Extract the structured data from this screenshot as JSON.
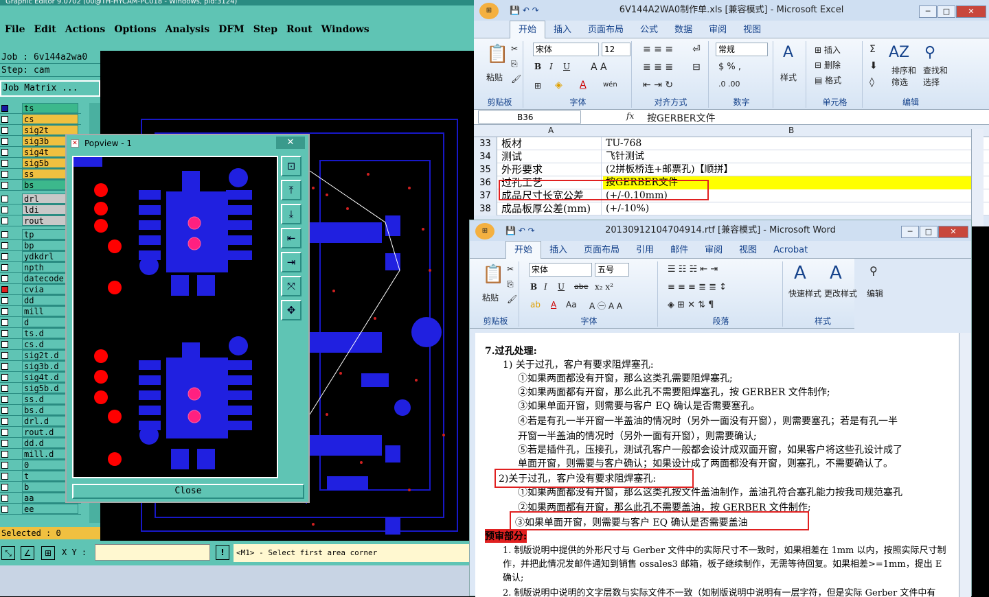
{
  "genesis": {
    "title": "Graphic Editor 9.0702 (00@TH-HYCAM-PC018 - Windows, pid:3124)",
    "menu": [
      "File",
      "Edit",
      "Actions",
      "Options",
      "Analysis",
      "DFM",
      "Step",
      "Rout",
      "Windows"
    ],
    "job_line": "Job : 6v144a2wa0",
    "step_line": "Step: cam",
    "matrix_btn": "Job Matrix ...",
    "layers": [
      {
        "name": "ts",
        "color": "#3cb88c"
      },
      {
        "name": "cs",
        "color": "#f0c040"
      },
      {
        "name": "sig2t",
        "color": "#f0c040"
      },
      {
        "name": "sig3b",
        "color": "#f0c040"
      },
      {
        "name": "sig4t",
        "color": "#f0c040"
      },
      {
        "name": "sig5b",
        "color": "#f0c040"
      },
      {
        "name": "ss",
        "color": "#f0c040"
      },
      {
        "name": "bs",
        "color": "#3cb88c"
      },
      {
        "name": "drl",
        "color": "#c8c8c8"
      },
      {
        "name": "ldi",
        "color": "#c8c8c8"
      },
      {
        "name": "rout",
        "color": "#c8c8c8"
      },
      {
        "name": "tp",
        "color": "#5fc4b4"
      },
      {
        "name": "bp",
        "color": "#5fc4b4"
      },
      {
        "name": "ydkdrl",
        "color": "#5fc4b4"
      },
      {
        "name": "npth",
        "color": "#5fc4b4"
      },
      {
        "name": "datecode",
        "color": "#5fc4b4"
      },
      {
        "name": "cvia",
        "color": "#5fc4b4"
      },
      {
        "name": "dd",
        "color": "#5fc4b4"
      },
      {
        "name": "mill",
        "color": "#5fc4b4"
      },
      {
        "name": "d",
        "color": "#5fc4b4"
      },
      {
        "name": "ts.d",
        "color": "#5fc4b4"
      },
      {
        "name": "cs.d",
        "color": "#5fc4b4"
      },
      {
        "name": "sig2t.d",
        "color": "#5fc4b4"
      },
      {
        "name": "sig3b.d",
        "color": "#5fc4b4"
      },
      {
        "name": "sig4t.d",
        "color": "#5fc4b4"
      },
      {
        "name": "sig5b.d",
        "color": "#5fc4b4"
      },
      {
        "name": "ss.d",
        "color": "#5fc4b4"
      },
      {
        "name": "bs.d",
        "color": "#5fc4b4"
      },
      {
        "name": "drl.d",
        "color": "#5fc4b4"
      },
      {
        "name": "rout.d",
        "color": "#5fc4b4"
      },
      {
        "name": "dd.d",
        "color": "#5fc4b4"
      },
      {
        "name": "mill.d",
        "color": "#5fc4b4"
      },
      {
        "name": "0",
        "color": "#5fc4b4"
      },
      {
        "name": "t",
        "color": "#5fc4b4"
      },
      {
        "name": "b",
        "color": "#5fc4b4"
      },
      {
        "name": "aa",
        "color": "#5fc4b4"
      },
      {
        "name": "ee",
        "color": "#5fc4b4"
      }
    ],
    "selected": "Selected : 0",
    "xy_label": "X Y :",
    "status_msg": "<M1> - Select first area corner",
    "popview": {
      "title": "Popview - 1",
      "close": "Close"
    }
  },
  "excel": {
    "title": "6V144A2WA0制作单.xls [兼容模式] - Microsoft Excel",
    "tabs": [
      "开始",
      "插入",
      "页面布局",
      "公式",
      "数据",
      "审阅",
      "视图"
    ],
    "font_name": "宋体",
    "font_size": "12",
    "num_format": "常规",
    "groups": [
      "剪贴板",
      "字体",
      "对齐方式",
      "数字",
      "单元格",
      "编辑"
    ],
    "paste": "粘贴",
    "styles": "样式",
    "cells_btns": [
      "插入",
      "删除",
      "格式"
    ],
    "edit_btns": [
      "排序和筛选",
      "查找和选择"
    ],
    "name_box": "B36",
    "fx": "fx",
    "formula": "按GERBER文件",
    "cols": [
      "A",
      "B"
    ],
    "rows": [
      {
        "n": "33",
        "a": "板材",
        "b": "TU-768"
      },
      {
        "n": "34",
        "a": "测试",
        "b": "飞针测试"
      },
      {
        "n": "35",
        "a": "外形要求",
        "b": "(2拼板桥连+邮票孔)【顺拼】"
      },
      {
        "n": "36",
        "a": "过孔工艺",
        "b": "按GERBER文件"
      },
      {
        "n": "37",
        "a": "成品尺寸长宽公差",
        "b": "(+/-0.10mm)"
      },
      {
        "n": "38",
        "a": "成品板厚公差(mm)",
        "b": "(+/-10%)"
      }
    ]
  },
  "word": {
    "title": "20130912104704914.rtf [兼容模式] - Microsoft Word",
    "tabs": [
      "开始",
      "插入",
      "页面布局",
      "引用",
      "邮件",
      "审阅",
      "视图",
      "Acrobat"
    ],
    "font_name": "宋体",
    "font_size": "五号",
    "groups": [
      "剪贴板",
      "字体",
      "段落",
      "样式"
    ],
    "paste": "粘贴",
    "quick_style": "快速样式",
    "change_style": "更改样式",
    "edit": "编辑",
    "lines": [
      "7.过孔处理:",
      "1) 关于过孔，客户有要求阻焊塞孔:",
      "①如果两面都没有开窗，那么这类孔需要阻焊塞孔;",
      "②如果两面都有开窗，那么此孔不需要阻焊塞孔，按 GERBER 文件制作;",
      "③如果单面开窗，则需要与客户 EQ 确认是否需要塞孔。",
      "④若是有孔一半开窗一半盖油的情况时（另外一面没有开窗），则需要塞孔；若是有孔一半",
      "开窗一半盖油的情况时（另外一面有开窗），则需要确认;",
      "⑤若是插件孔，压接孔，测试孔客户一般都会设计成双面开窗，如果客户将这些孔设计成了",
      "单面开窗，则需要与客户确认；如果设计成了两面都没有开窗，则塞孔，不需要确认了。",
      "2)关于过孔，客户没有要求阻焊塞孔:",
      "①如果两面都没有开窗，那么这类孔按文件盖油制作，盖油孔符合塞孔能力按我司规范塞孔",
      "②如果两面都有开窗，那么此孔不需要盖油，按 GERBER 文件制作;",
      "③如果单面开窗，则需要与客户 EQ 确认是否需要盖油",
      "预审部分:",
      "1. 制版说明中提供的外形尺寸与 Gerber 文件中的实际尺寸不一致时，如果相差在 1mm 以内，按照实际尺寸制",
      "作，并把此情况发邮件通知到销售 ossales3 邮箱，板子继续制作，无需等待回复。如果相差>=1mm，提出 E",
      "确认;",
      "2. 制版说明中说明的文字层数与实际文件不一致（如制版说明中说明有一层字符，但是实际 Gerber 文件中有"
    ]
  }
}
